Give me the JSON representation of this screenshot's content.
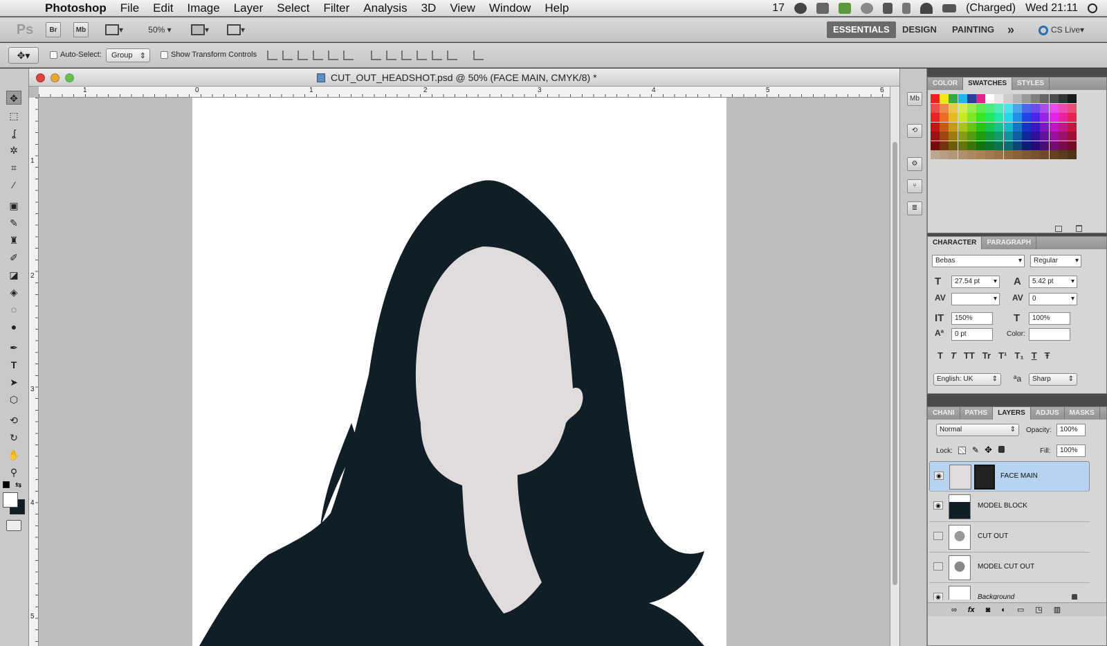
{
  "menubar": {
    "app": "Photoshop",
    "menus": [
      "File",
      "Edit",
      "Image",
      "Layer",
      "Select",
      "Filter",
      "Analysis",
      "3D",
      "View",
      "Window",
      "Help"
    ],
    "status_items": [
      "17"
    ],
    "battery": "(Charged)",
    "clock": "Wed 21:11"
  },
  "appbar": {
    "ps_logo": "Ps",
    "bridge": "Br",
    "mini_bridge": "Mb",
    "zoom": "50%",
    "workspaces": [
      "ESSENTIALS",
      "DESIGN",
      "PAINTING"
    ],
    "more": "»",
    "cs_live": "CS Live"
  },
  "options": {
    "auto_select_label": "Auto-Select:",
    "auto_select_value": "Group",
    "show_transform": "Show Transform Controls"
  },
  "document": {
    "title": "CUT_OUT_HEADSHOT.psd @ 50% (FACE MAIN, CMYK/8) *",
    "ruler_h": [
      "1",
      "0",
      "1",
      "2",
      "3",
      "4",
      "5",
      "6"
    ],
    "ruler_v": [
      "1",
      "2",
      "3",
      "4",
      "5"
    ]
  },
  "swatches_panel": {
    "tabs": [
      "COLOR",
      "SWATCHES",
      "STYLES"
    ],
    "active": "SWATCHES"
  },
  "character_panel": {
    "tabs": [
      "CHARACTER",
      "PARAGRAPH"
    ],
    "font_family": "Bebas",
    "font_style": "Regular",
    "size": "27.54 pt",
    "leading": "5.42 pt",
    "kerning": "",
    "tracking": "0",
    "vertical_scale": "150%",
    "horizontal_scale": "100%",
    "baseline": "0 pt",
    "color_label": "Color:",
    "style_buttons": [
      "T",
      "T",
      "TT",
      "Tr",
      "T¹",
      "T₁",
      "T",
      "Ŧ"
    ],
    "language": "English: UK",
    "aa_glyph": "ªa",
    "antialias": "Sharp"
  },
  "layers_panel": {
    "tabs": [
      "CHANI",
      "PATHS",
      "LAYERS",
      "ADJUS",
      "MASKS"
    ],
    "active": "LAYERS",
    "blend_mode": "Normal",
    "opacity_label": "Opacity:",
    "opacity": "100%",
    "lock_label": "Lock:",
    "fill_label": "Fill:",
    "fill": "100%",
    "layers": [
      {
        "name": "FACE MAIN",
        "visible": true,
        "selected": true
      },
      {
        "name": "MODEL BLOCK",
        "visible": true,
        "selected": false
      },
      {
        "name": "CUT OUT",
        "visible": false,
        "selected": false
      },
      {
        "name": "MODEL CUT OUT",
        "visible": false,
        "selected": false
      },
      {
        "name": "Background",
        "visible": true,
        "selected": false
      }
    ],
    "footer_icons": [
      "link-icon",
      "fx-icon",
      "mask-icon",
      "adjustment-icon",
      "folder-icon",
      "new-layer-icon",
      "trash-icon"
    ]
  },
  "colors": {
    "hair": "#0f1e27",
    "skin": "#e1dcdc",
    "selection": "#b8d3ef"
  }
}
